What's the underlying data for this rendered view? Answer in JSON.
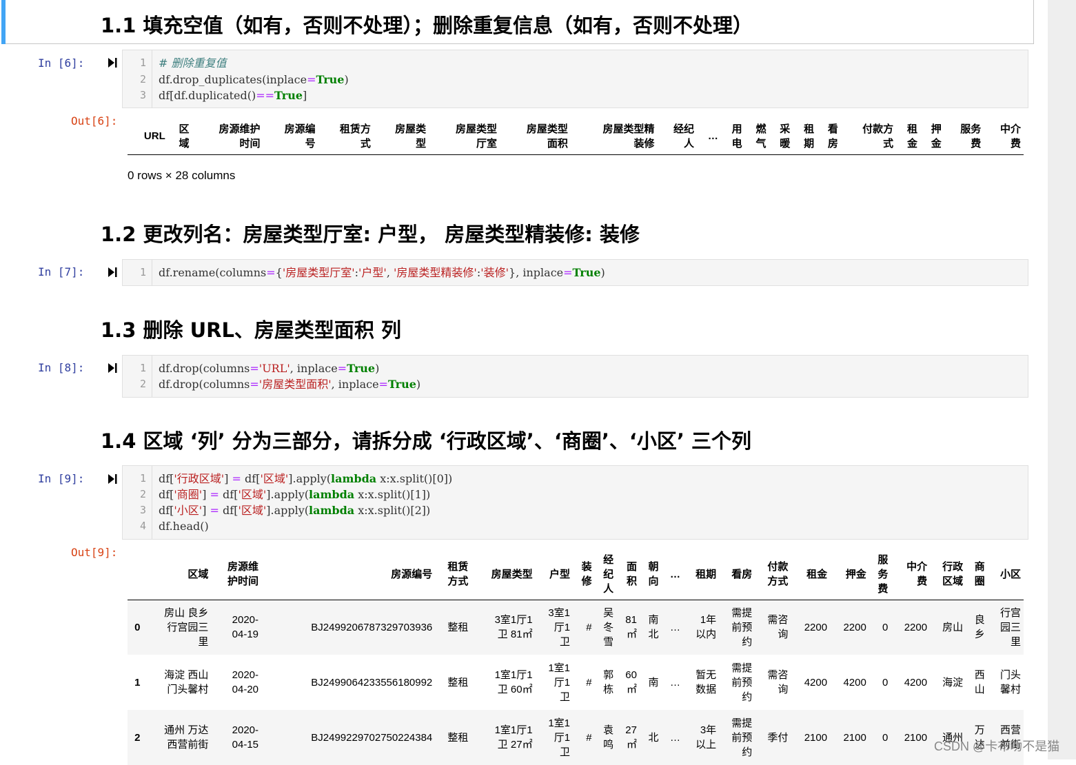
{
  "headings": {
    "h1_1": "1.1 填充空值（如有，否则不处理）；删除重复信息（如有，否则不处理）",
    "h1_2": "1.2 更改列名：房屋类型厅室: 户型， 房屋类型精装修: 装修",
    "h1_3": "1.3 删除 URL、房屋类型面积 列",
    "h1_4": "1.4 区域 ‘列’ 分为三部分，请拆分成 ‘行政区域’、‘商圈’、‘小区’ 三个列"
  },
  "cells": {
    "c6": {
      "in_prompt": "In  [6]:",
      "out_prompt": "Out[6]:"
    },
    "c7": {
      "in_prompt": "In  [7]:"
    },
    "c8": {
      "in_prompt": "In  [8]:"
    },
    "c9": {
      "in_prompt": "In  [9]:",
      "out_prompt": "Out[9]:"
    }
  },
  "out6": {
    "headers": [
      "URL",
      "区\n域",
      "房源维护\n时间",
      "房源编\n号",
      "租赁方\n式",
      "房屋类\n型",
      "房屋类型\n厅室",
      "房屋类型\n面积",
      "房屋类型精\n装修",
      "经纪\n人",
      "…",
      "用\n电",
      "燃\n气",
      "采\n暖",
      "租\n期",
      "看\n房",
      "付款方\n式",
      "租\n金",
      "押\n金",
      "服务\n费",
      "中介\n费"
    ],
    "rows_info": "0 rows × 28 columns"
  },
  "out9": {
    "headers": [
      "",
      "区域",
      "房源维\n护时间",
      "房源编号",
      "租赁\n方式",
      "房屋类型",
      "户型",
      "装\n修",
      "经\n纪\n人",
      "面\n积",
      "朝\n向",
      "…",
      "租期",
      "看房",
      "付款\n方式",
      "租金",
      "押金",
      "服\n务\n费",
      "中介\n费",
      "行政\n区域",
      "商\n圈",
      "小区"
    ],
    "rows": [
      [
        "0",
        "房山 良乡\n行宫园三\n里",
        "2020-\n04-19",
        "BJ2499206787329703936",
        "整租",
        "3室1厅1\n卫 81㎡",
        "3室1\n厅1\n卫",
        "#",
        "吴\n冬\n雪",
        "81\n㎡",
        "南\n北",
        "…",
        "1年\n以内",
        "需提\n前预\n约",
        "需咨\n询",
        "2200",
        "2200",
        "0",
        "2200",
        "房山",
        "良\n乡",
        "行宫\n园三\n里"
      ],
      [
        "1",
        "海淀 西山\n门头馨村",
        "2020-\n04-20",
        "BJ2499064233556180992",
        "整租",
        "1室1厅1\n卫 60㎡",
        "1室1\n厅1\n卫",
        "#",
        "郭\n栋",
        "60\n㎡",
        "南",
        "…",
        "暂无\n数据",
        "需提\n前预\n约",
        "需咨\n询",
        "4200",
        "4200",
        "0",
        "4200",
        "海淀",
        "西\n山",
        "门头\n馨村"
      ],
      [
        "2",
        "通州 万达\n西营前街",
        "2020-\n04-15",
        "BJ2499229702750224384",
        "整租",
        "1室1厅1\n卫 27㎡",
        "1室1\n厅1\n卫",
        "#",
        "袁\n鸣",
        "27\n㎡",
        "北",
        "…",
        "3年\n以上",
        "需提\n前预\n约",
        "季付",
        "2100",
        "2100",
        "0",
        "2100",
        "通州",
        "万\n达",
        "西营\n前街"
      ]
    ]
  },
  "watermark": "CSDN @卡布叻不是猫"
}
